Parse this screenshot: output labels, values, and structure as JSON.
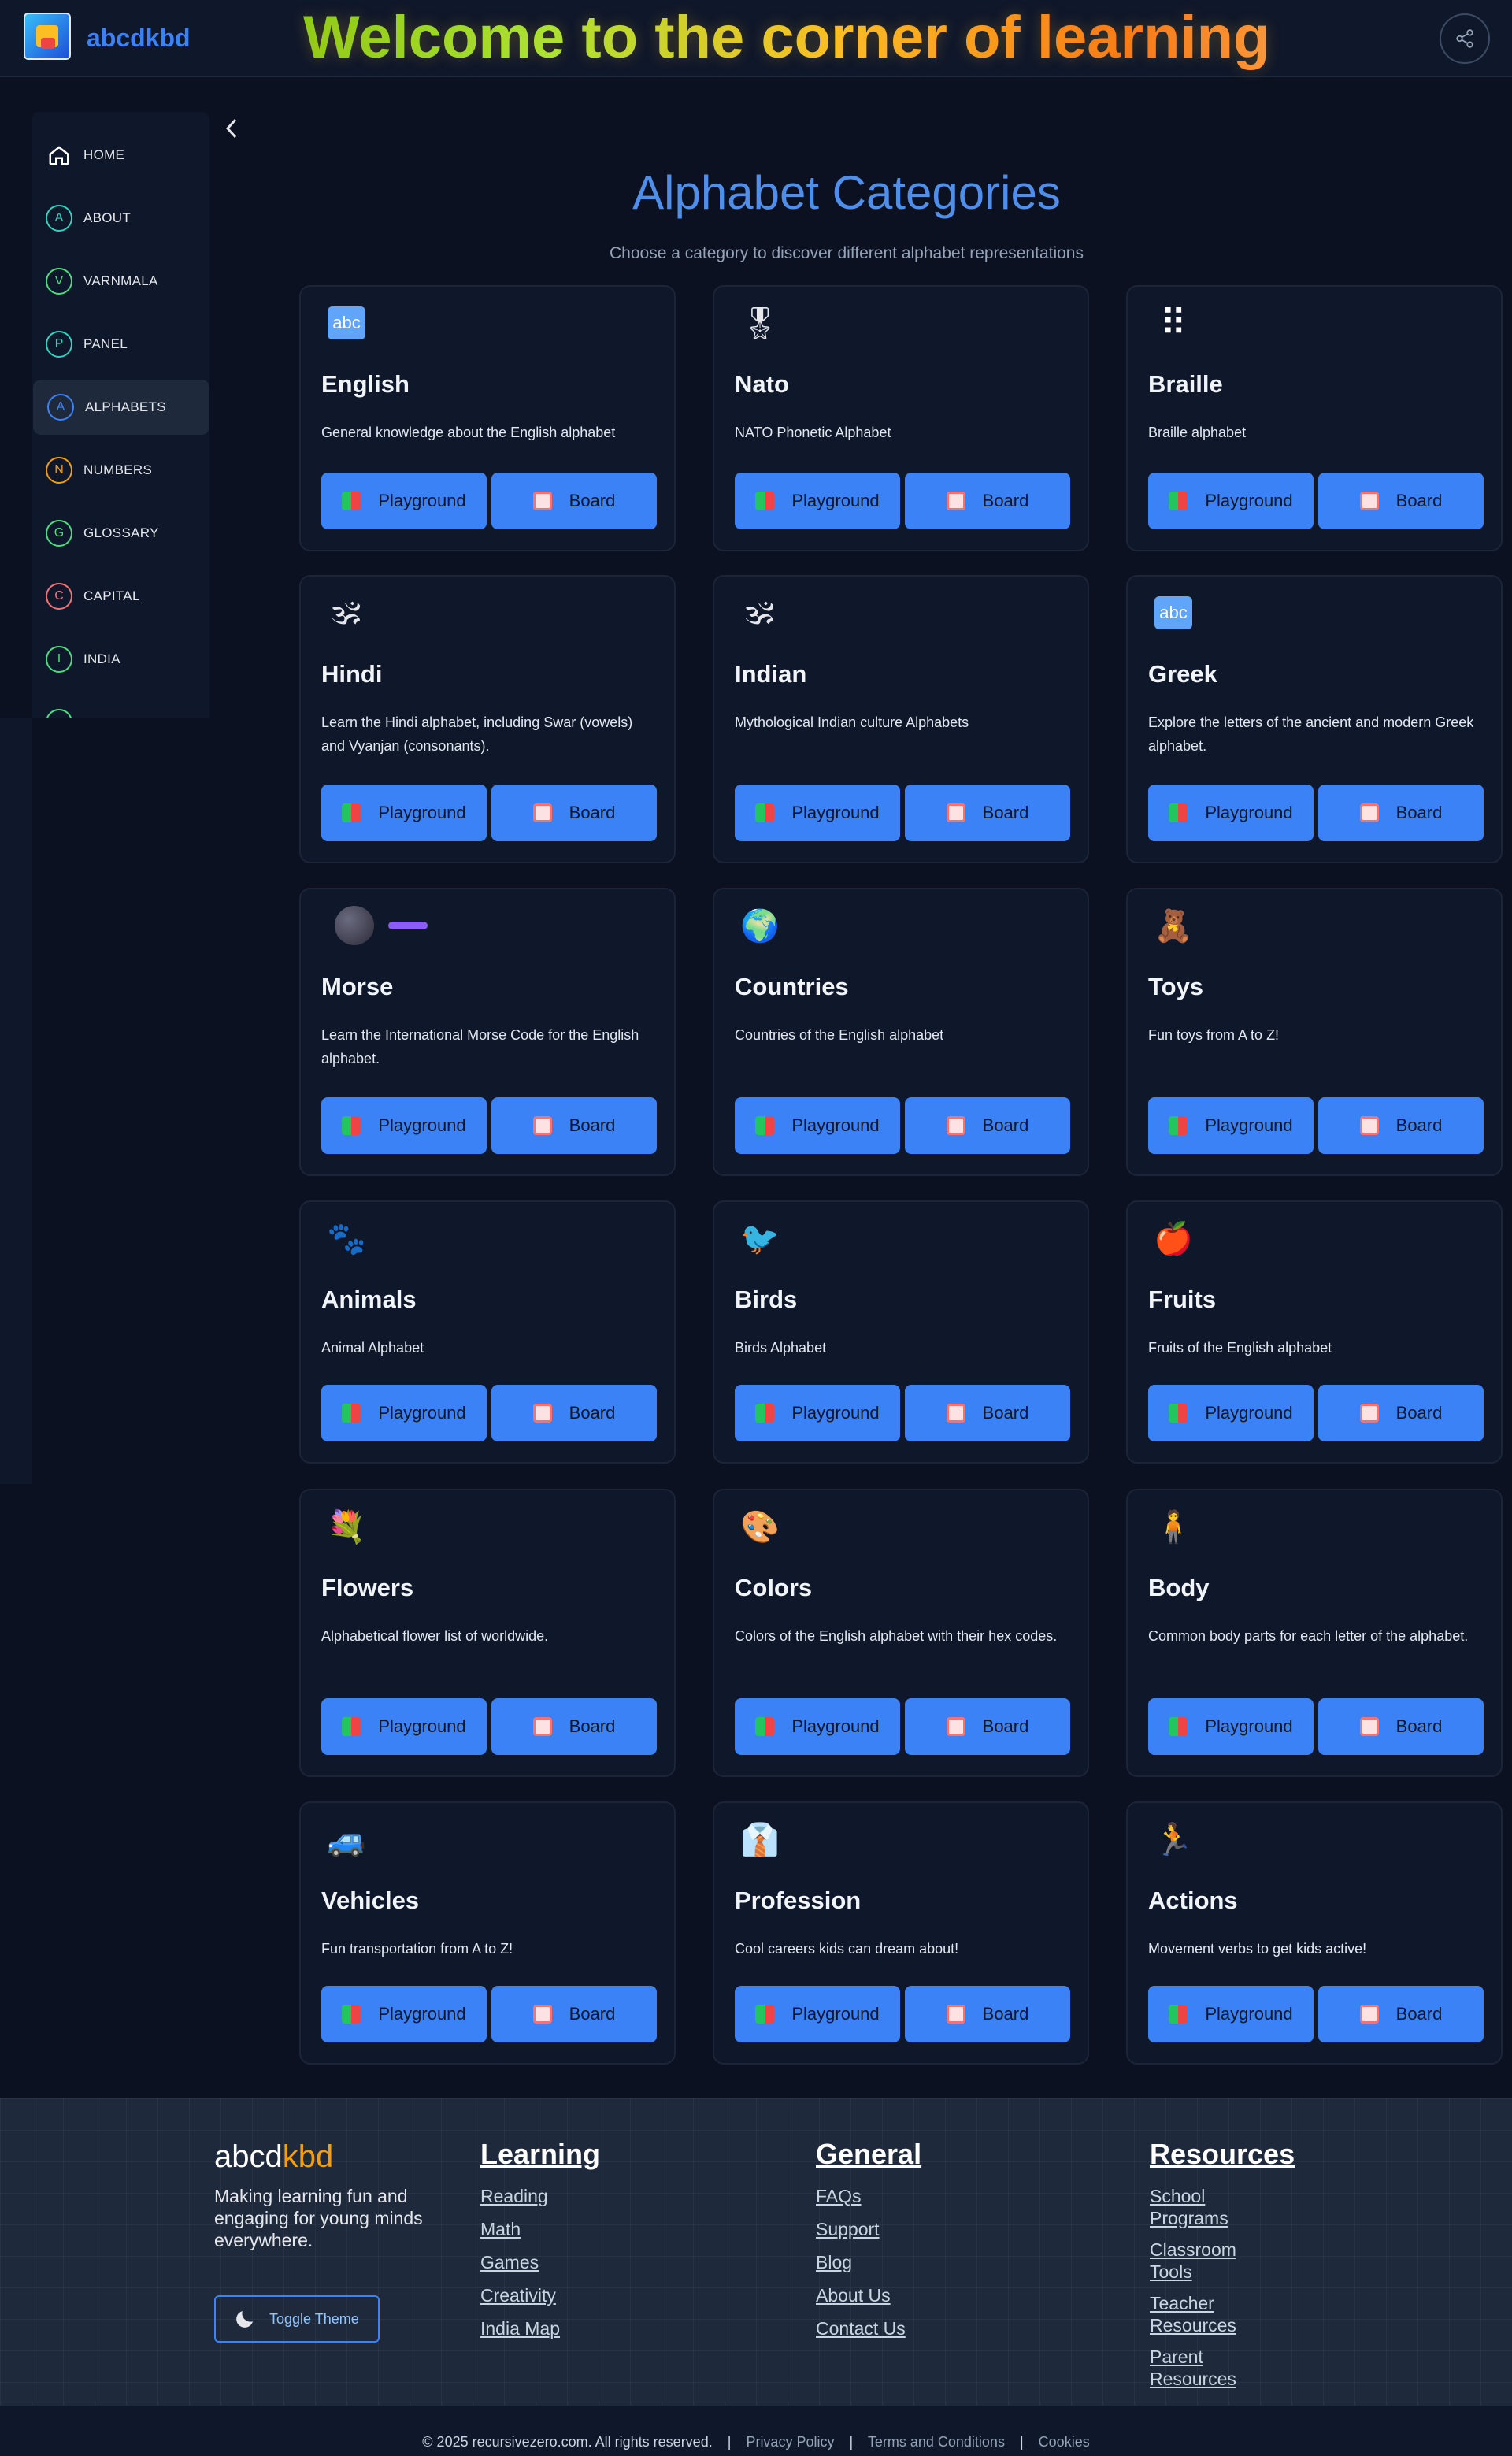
{
  "header": {
    "brand": "abcdkbd",
    "welcome": "Welcome to the corner of learning"
  },
  "sidebar": {
    "items": [
      {
        "label": "HOME",
        "letter": "",
        "color": "#ffffff"
      },
      {
        "label": "ABOUT",
        "letter": "A",
        "color": "#2dd4bf"
      },
      {
        "label": "VARNMALA",
        "letter": "V",
        "color": "#4ade80"
      },
      {
        "label": "PANEL",
        "letter": "P",
        "color": "#2dd4bf"
      },
      {
        "label": "ALPHABETS",
        "letter": "A",
        "color": "#3b82f6"
      },
      {
        "label": "NUMBERS",
        "letter": "N",
        "color": "#f59e0b"
      },
      {
        "label": "GLOSSARY",
        "letter": "G",
        "color": "#4ade80"
      },
      {
        "label": "CAPITAL",
        "letter": "C",
        "color": "#f87171"
      },
      {
        "label": "INDIA",
        "letter": "I",
        "color": "#4ade80"
      }
    ]
  },
  "main": {
    "title": "Alphabet Categories",
    "subtitle": "Choose a category to discover different alphabet representations",
    "playground_label": "Playground",
    "board_label": "Board",
    "categories": [
      {
        "name": "English",
        "desc": "General knowledge about the English alphabet",
        "icon": "abc-icon",
        "glyph": "abc"
      },
      {
        "name": "Nato",
        "desc": "NATO Phonetic Alphabet",
        "icon": "medal-icon",
        "glyph": "🎖"
      },
      {
        "name": "Braille",
        "desc": "Braille alphabet",
        "icon": "braille-icon",
        "glyph": "⠿"
      },
      {
        "name": "Hindi",
        "desc": "Learn the Hindi alphabet, including Swar (vowels) and Vyanjan (consonants).",
        "icon": "om-icon",
        "glyph": "🕉"
      },
      {
        "name": "Indian",
        "desc": "Mythological Indian culture Alphabets",
        "icon": "om-icon",
        "glyph": "🕉"
      },
      {
        "name": "Greek",
        "desc": "Explore the letters of the ancient and modern Greek alphabet.",
        "icon": "abc-icon",
        "glyph": "abc"
      },
      {
        "name": "Morse",
        "desc": "Learn the International Morse Code for the English alphabet.",
        "icon": "morse-icon",
        "glyph": "●"
      },
      {
        "name": "Countries",
        "desc": "Countries of the English alphabet",
        "icon": "globe-icon",
        "glyph": "🌍"
      },
      {
        "name": "Toys",
        "desc": "Fun toys from A to Z!",
        "icon": "teddy-bear-icon",
        "glyph": "🧸"
      },
      {
        "name": "Animals",
        "desc": "Animal Alphabet",
        "icon": "paw-icon",
        "glyph": "🐾"
      },
      {
        "name": "Birds",
        "desc": "Birds Alphabet",
        "icon": "bird-icon",
        "glyph": "🐦"
      },
      {
        "name": "Fruits",
        "desc": "Fruits of the English alphabet",
        "icon": "apple-icon",
        "glyph": "🍎"
      },
      {
        "name": "Flowers",
        "desc": "Alphabetical flower list of worldwide.",
        "icon": "flowers-icon",
        "glyph": "💐"
      },
      {
        "name": "Colors",
        "desc": "Colors of the English alphabet with their hex codes.",
        "icon": "palette-icon",
        "glyph": "🎨"
      },
      {
        "name": "Body",
        "desc": "Common body parts for each letter of the alphabet.",
        "icon": "person-icon",
        "glyph": "🧍"
      },
      {
        "name": "Vehicles",
        "desc": "Fun transportation from A to Z!",
        "icon": "car-icon",
        "glyph": "🚙"
      },
      {
        "name": "Profession",
        "desc": "Cool careers kids can dream about!",
        "icon": "suit-icon",
        "glyph": "👔"
      },
      {
        "name": "Actions",
        "desc": "Movement verbs to get kids active!",
        "icon": "runner-icon",
        "glyph": "🏃"
      }
    ]
  },
  "footer": {
    "brand_a": "abcd",
    "brand_b": "kbd",
    "tagline": "Making learning fun and engaging for young minds everywhere.",
    "toggle_label": "Toggle Theme",
    "learning": {
      "title": "Learning",
      "links": [
        "Reading",
        "Math",
        "Games",
        "Creativity",
        "India Map"
      ]
    },
    "general": {
      "title": "General",
      "links": [
        "FAQs",
        "Support",
        "Blog",
        "About Us",
        "Contact Us"
      ]
    },
    "resources": {
      "title": "Resources",
      "links": [
        "School Programs",
        "Classroom Tools",
        "Teacher Resources",
        "Parent Resources"
      ]
    },
    "copyright": "© 2025 recursivezero.com. All rights reserved.",
    "legal": [
      "Privacy Policy",
      "Terms and Conditions",
      "Cookies"
    ]
  }
}
